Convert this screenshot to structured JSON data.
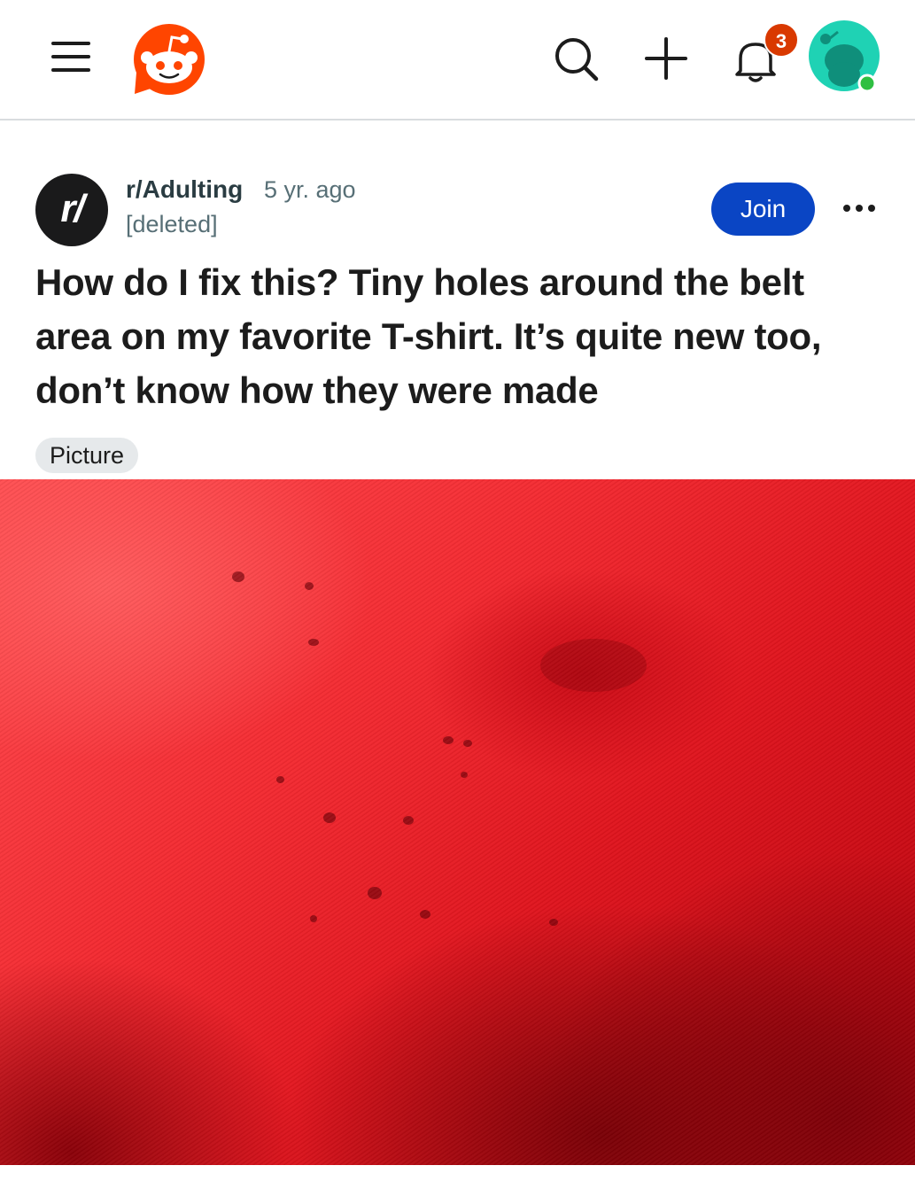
{
  "header": {
    "notification_count": "3",
    "icons": [
      "menu-icon",
      "reddit-logo",
      "search-icon",
      "plus-icon",
      "bell-icon",
      "user-avatar"
    ],
    "colors": {
      "brand": "#ff4500",
      "badge": "#d93900",
      "avatar_bg": "#1fd2b4",
      "online": "#2fbf42"
    }
  },
  "post": {
    "subreddit": "r/Adulting",
    "subreddit_icon_text": "r/",
    "age": "5 yr. ago",
    "author": "[deleted]",
    "join_label": "Join",
    "title": "How do I fix this? Tiny holes around the belt area on my favorite T-shirt. It’s quite new too, don’t know how they were made",
    "flair": "Picture",
    "colors": {
      "join": "#0a45c4",
      "image_dominant": "#e8141d"
    }
  }
}
